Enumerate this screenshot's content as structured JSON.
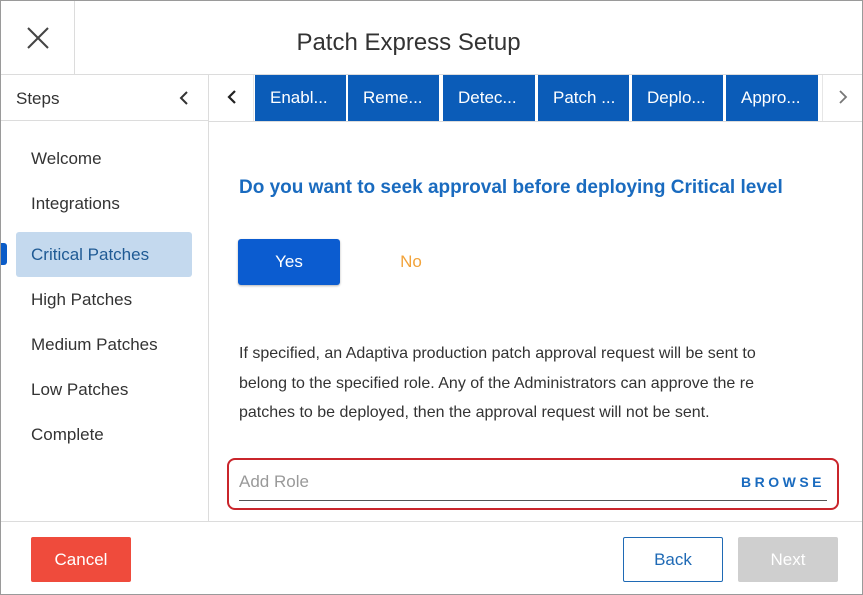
{
  "window": {
    "title": "Patch Express Setup"
  },
  "sidebar": {
    "header": "Steps",
    "items": [
      {
        "label": "Welcome"
      },
      {
        "label": "Integrations"
      },
      {
        "label": "Critical Patches",
        "active": true
      },
      {
        "label": "High Patches"
      },
      {
        "label": "Medium Patches"
      },
      {
        "label": "Low Patches"
      },
      {
        "label": "Complete"
      }
    ]
  },
  "tabs": [
    {
      "label": "Enabl..."
    },
    {
      "label": "Reme..."
    },
    {
      "label": "Detec..."
    },
    {
      "label": "Patch ..."
    },
    {
      "label": "Deplo..."
    },
    {
      "label": "Appro..."
    }
  ],
  "main": {
    "question": "Do you want to seek approval before deploying Critical level",
    "yes_label": "Yes",
    "no_label": "No",
    "description_lines": [
      "If specified, an Adaptiva production patch approval request will be sent to",
      "belong to the specified role. Any of the Administrators can approve the re",
      "patches to be deployed, then the approval request will not be sent."
    ],
    "role_placeholder": "Add Role",
    "role_value": "",
    "browse_label": "BROWSE"
  },
  "footer": {
    "cancel_label": "Cancel",
    "back_label": "Back",
    "next_label": "Next"
  },
  "colors": {
    "tab_blue": "#0b5cb8",
    "primary_blue": "#0b5cd0",
    "link_blue": "#1a6bbf",
    "active_step_bg": "#c4d9ee",
    "no_orange": "#f2a33a",
    "cancel_red": "#ef4b3c",
    "highlight_red": "#c9252b",
    "disabled_gray": "#cfcfcf"
  },
  "icons": {
    "close": "close-icon",
    "collapse": "chevron-left-icon",
    "tab_prev": "chevron-left-icon",
    "tab_next": "chevron-right-icon"
  }
}
